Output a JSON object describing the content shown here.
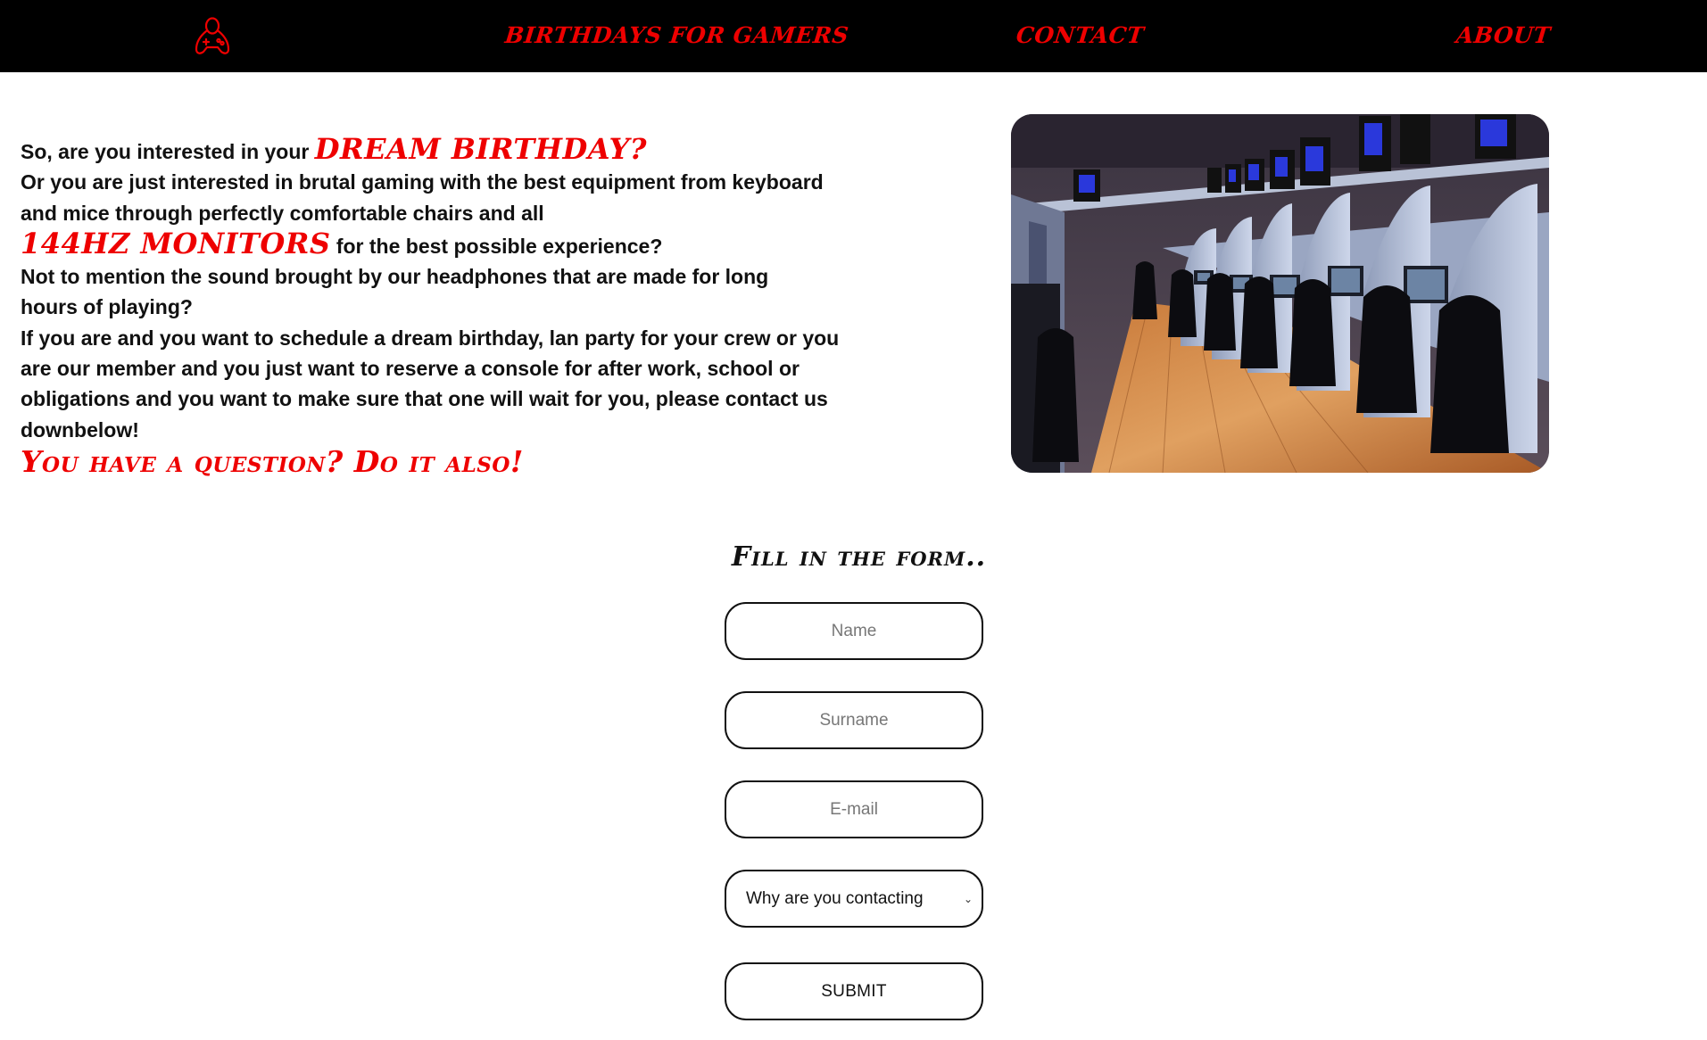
{
  "colors": {
    "accent": "#ee0000",
    "nav_bg": "#000000",
    "text": "#111111"
  },
  "nav": {
    "logo_icon": "gamer-controller-logo-icon",
    "links": [
      "BIRTHDAYS FOR GAMERS",
      "CONTACT",
      "ABOUT"
    ]
  },
  "intro": {
    "line1_text": "So, are you interested in your ",
    "line1_accent": "DREAM BIRTHDAY?",
    "line2": "Or you are just interested in brutal gaming with the best equipment from keyboard and mice through perfectly comfortable chairs and all",
    "accent_monitors": "144HZ MONITORS",
    "monitors_text": " for the best possible experience?",
    "line3": "Not to mention the sound brought by our headphones that are made for long hours of playing?",
    "line4": "If you are and you want to schedule a dream birthday, lan party for your crew or you are our member and you just want to reserve a console for after work, school or obligations and you want to make sure that one will wait for you, please contact us downbelow!",
    "question_accent": "You have a question? Do it also!"
  },
  "photo": {
    "icon": "gaming-room-photo"
  },
  "form": {
    "title": "Fill in the form..",
    "name_placeholder": "Name",
    "surname_placeholder": "Surname",
    "email_placeholder": "E-mail",
    "reason_selected": "Why are you contacting",
    "submit_label": "SUBMIT"
  }
}
